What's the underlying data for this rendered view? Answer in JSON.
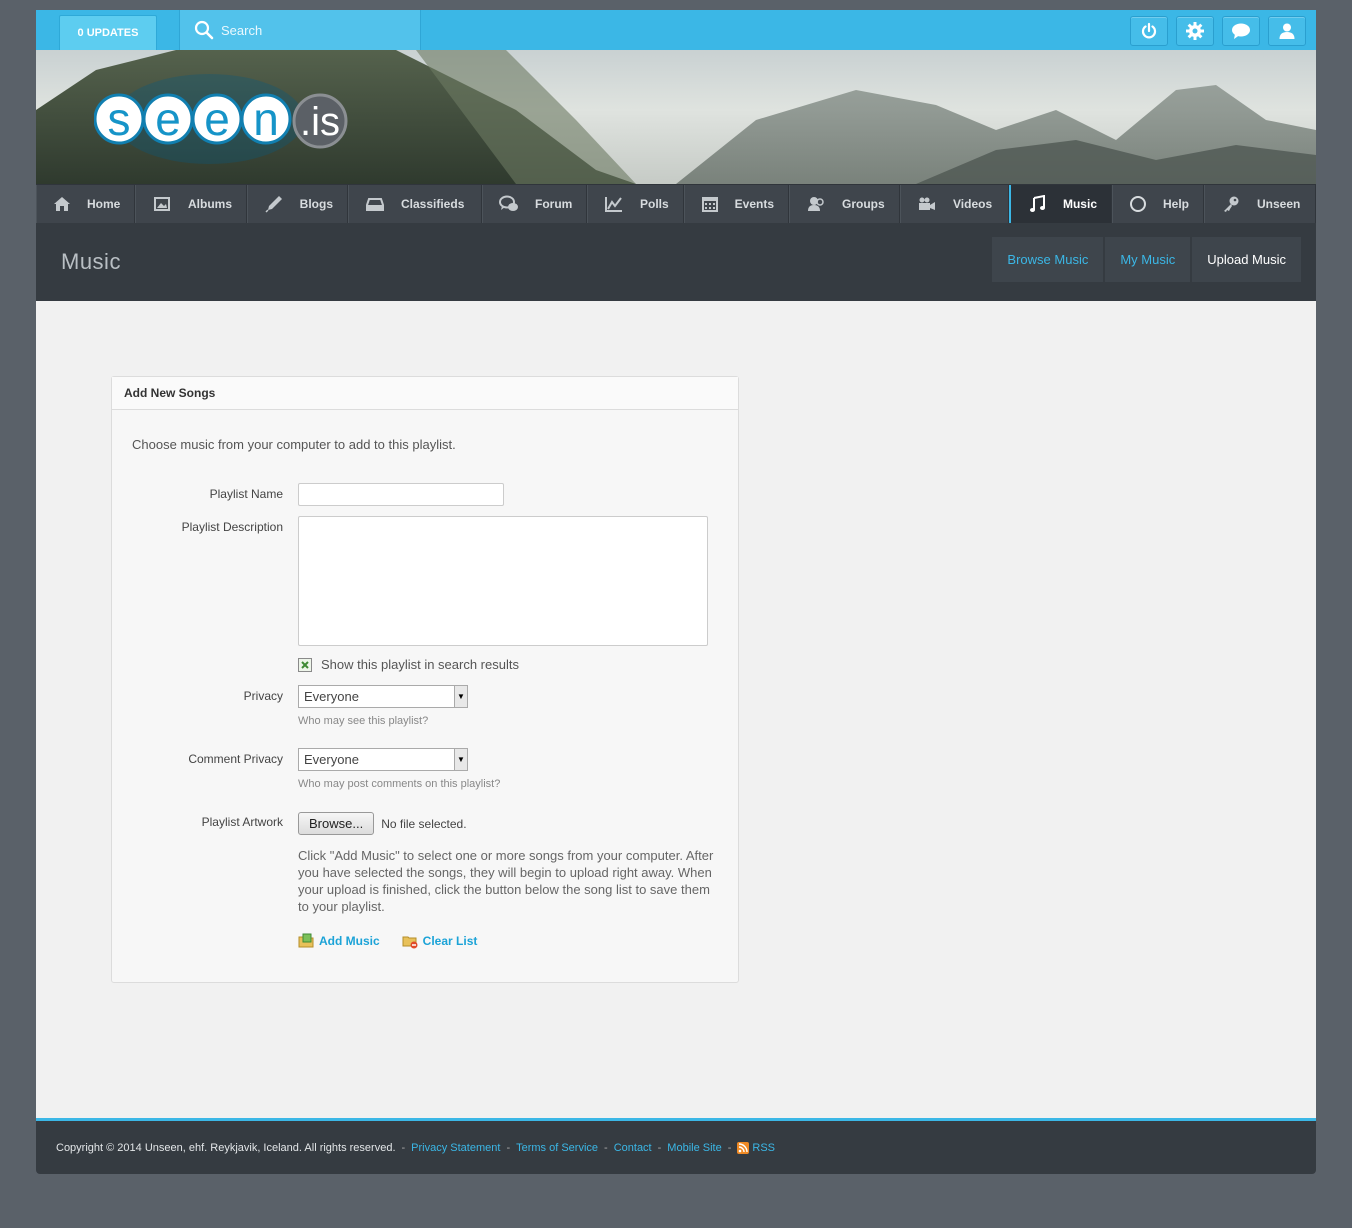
{
  "topbar": {
    "updates_label": "0 UPDATES",
    "search_placeholder": "Search",
    "buttons": [
      "power-icon",
      "gear-icon",
      "chat-icon",
      "user-icon"
    ]
  },
  "logo": {
    "text": "seen",
    "suffix": ".is"
  },
  "nav": {
    "items": [
      {
        "label": "Home",
        "icon": "home-icon"
      },
      {
        "label": "Albums",
        "icon": "image-icon"
      },
      {
        "label": "Blogs",
        "icon": "pen-icon"
      },
      {
        "label": "Classifieds",
        "icon": "box-icon"
      },
      {
        "label": "Forum",
        "icon": "comments-icon"
      },
      {
        "label": "Polls",
        "icon": "chart-icon"
      },
      {
        "label": "Events",
        "icon": "calendar-icon"
      },
      {
        "label": "Groups",
        "icon": "group-icon"
      },
      {
        "label": "Videos",
        "icon": "video-icon"
      },
      {
        "label": "Music",
        "icon": "music-icon",
        "active": true
      },
      {
        "label": "Help",
        "icon": "circle-icon"
      },
      {
        "label": "Unseen",
        "icon": "key-icon"
      }
    ]
  },
  "page": {
    "title": "Music",
    "tabs": [
      {
        "label": "Browse Music"
      },
      {
        "label": "My Music"
      },
      {
        "label": "Upload Music",
        "active": true
      }
    ]
  },
  "form": {
    "heading": "Add New Songs",
    "intro": "Choose music from your computer to add to this playlist.",
    "playlist_name_label": "Playlist Name",
    "playlist_name_value": "",
    "playlist_description_label": "Playlist Description",
    "playlist_description_value": "",
    "search_checkbox_label": "Show this playlist in search results",
    "search_checkbox_checked": true,
    "privacy_label": "Privacy",
    "privacy_value": "Everyone",
    "privacy_hint": "Who may see this playlist?",
    "comment_privacy_label": "Comment Privacy",
    "comment_privacy_value": "Everyone",
    "comment_privacy_hint": "Who may post comments on this playlist?",
    "artwork_label": "Playlist Artwork",
    "browse_button": "Browse...",
    "no_file_text": "No file selected.",
    "instructions": "Click \"Add Music\" to select one or more songs from your computer. After you have selected the songs, they will begin to upload right away. When your upload is finished, click the button below the song list to save them to your playlist.",
    "add_music": "Add Music",
    "clear_list": "Clear List"
  },
  "footer": {
    "copyright": "Copyright © 2014 Unseen, ehf. Reykjavik, Iceland. All rights reserved.",
    "links": [
      "Privacy Statement",
      "Terms of Service",
      "Contact",
      "Mobile Site"
    ],
    "rss": "RSS"
  },
  "colors": {
    "accent": "#3bb7e6",
    "nav_bg": "#3f454c",
    "header_bg": "#353b41",
    "page_bg": "#5a6169"
  }
}
